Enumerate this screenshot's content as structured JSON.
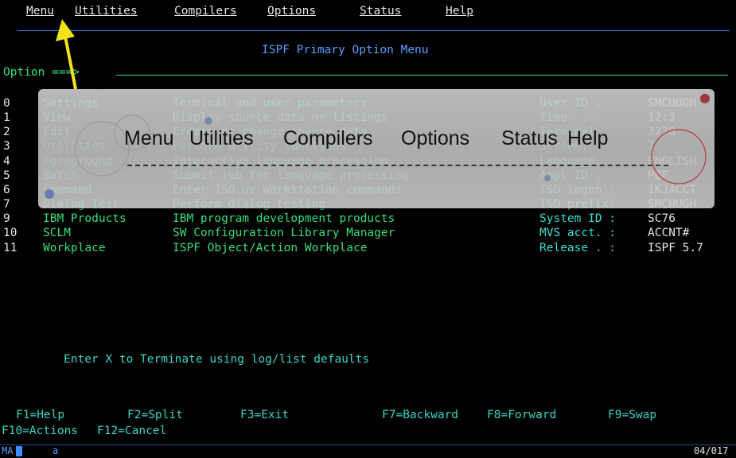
{
  "menubar": {
    "items": [
      "Menu",
      "Utilities",
      "Compilers",
      "Options",
      "Status",
      "Help"
    ]
  },
  "panel": {
    "title": "ISPF Primary Option Menu",
    "option_prompt": "Option ===>",
    "option_value": ""
  },
  "options": [
    {
      "num": "0",
      "name": "Settings",
      "desc": "Terminal and user parameters",
      "info_label": "User ID .",
      "info_value": "SMCHUGH"
    },
    {
      "num": "1",
      "name": "View",
      "desc": "Display source data or listings",
      "info_label": "Time. . .",
      "info_value": "12:3"
    },
    {
      "num": "2",
      "name": "Edit",
      "desc": "Create or change source data",
      "info_label": "Terminal.",
      "info_value": "3278"
    },
    {
      "num": "3",
      "name": "Utilities",
      "desc": "Perform utility functions",
      "info_label": "Screen. .",
      "info_value": "1"
    },
    {
      "num": "4",
      "name": "Foreground",
      "desc": "Interactive language processing",
      "info_label": "Language.",
      "info_value": "ENGLISH"
    },
    {
      "num": "5",
      "name": "Batch",
      "desc": "Submit job for language processing",
      "info_label": "Appl ID .",
      "info_value": "PDF"
    },
    {
      "num": "6",
      "name": "Command",
      "desc": "Enter TSO or Workstation commands",
      "info_label": "TSO logon :",
      "info_value": "IKJACCT"
    },
    {
      "num": "7",
      "name": "Dialog Test",
      "desc": "Perform dialog testing",
      "info_label": "TSO prefix:",
      "info_value": "SMCHUGH"
    },
    {
      "num": "9",
      "name": "IBM Products",
      "desc": "IBM program development products",
      "info_label": "System ID :",
      "info_value": "SC76"
    },
    {
      "num": "10",
      "name": "SCLM",
      "desc": "SW Configuration Library Manager",
      "info_label": "MVS acct. :",
      "info_value": "ACCNT#"
    },
    {
      "num": "11",
      "name": "Workplace",
      "desc": "ISPF Object/Action Workplace",
      "info_label": "Release . :",
      "info_value": "ISPF 5.7"
    }
  ],
  "overlay_menu": [
    "Menu",
    "Utilities",
    "Compilers",
    "Options",
    "Status",
    "Help"
  ],
  "terminate_msg": "Enter X to Terminate using log/list defaults",
  "fkeys_row1": [
    "F1=Help",
    "F2=Split",
    "F3=Exit",
    "F7=Backward",
    "F8=Forward",
    "F9=Swap"
  ],
  "fkeys_row2": [
    "F10=Actions",
    "F12=Cancel"
  ],
  "status": {
    "left": "MA",
    "session": "a",
    "cursor": "04/017"
  },
  "colors": {
    "accent_blue": "#3d6fd6",
    "green": "#34e07a",
    "cyan": "#33e0d0",
    "arrow": "#f2e21a"
  }
}
